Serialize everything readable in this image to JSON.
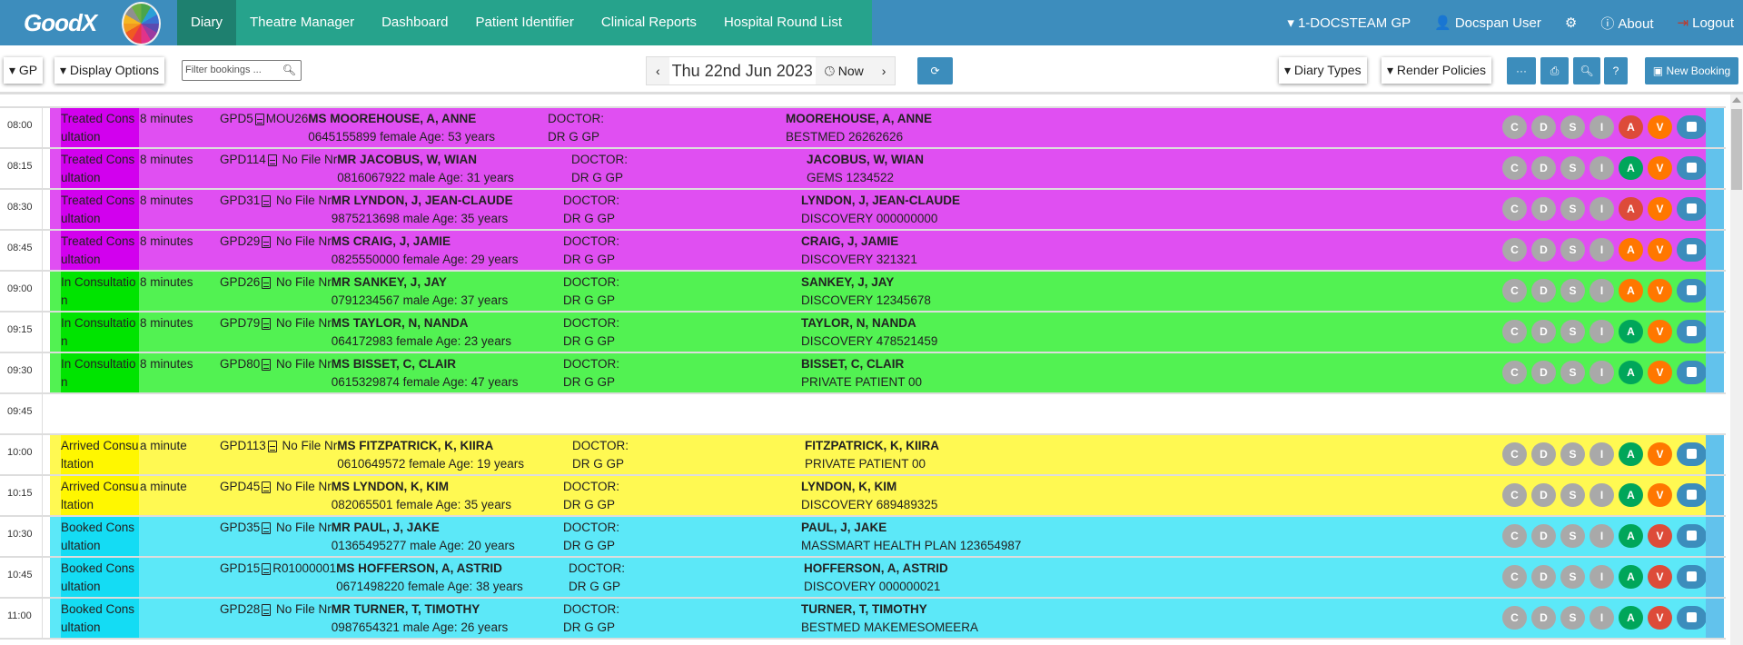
{
  "nav": {
    "logo_text": "GoodX",
    "tabs": [
      "Diary",
      "Theatre Manager",
      "Dashboard",
      "Patient Identifier",
      "Clinical Reports",
      "Hospital Round List"
    ],
    "practice": "1-DOCSTEAM GP",
    "user": "Docspan User",
    "about": "About",
    "logout": "Logout"
  },
  "toolbar": {
    "gp": "GP",
    "display_options": "Display Options",
    "filter_placeholder": "Filter bookings ...",
    "date": "Thu 22nd Jun 2023",
    "now": "Now",
    "diary_types": "Diary Types",
    "render_policies": "Render Policies",
    "more": "···",
    "help": "?",
    "new_booking": "New Booking"
  },
  "colors": {
    "Treated": {
      "band": "#e04ff2",
      "status": "#d200ee"
    },
    "In Consultation": {
      "band": "#52f252",
      "status": "#00e400"
    },
    "Arrived": {
      "band": "#fff952",
      "status": "#fff700"
    },
    "Booked": {
      "band": "#5ce8f8",
      "status": "#14dcf4"
    },
    "grey": "#a9a9a9",
    "red": "#dd4b39",
    "green": "#00a65a",
    "orange": "#ff7700"
  },
  "badge_letters": [
    "C",
    "D",
    "S",
    "I",
    "A",
    "V"
  ],
  "rows": [
    {
      "time": "08:00",
      "state": "Treated",
      "status": "Treated Consultation",
      "duration": "8 minutes",
      "code": "GPD5",
      "file": "MOU26",
      "name": "MS MOOREHOUSE, A, ANNE",
      "details": "0645155899 female Age: 53 years",
      "doctor_label": "DOCTOR:",
      "doctor": "DR G GP",
      "aid_name": "MOOREHOUSE, A, ANNE",
      "aid": "BESTMED 26262626",
      "a": "red",
      "v": "orange"
    },
    {
      "time": "08:15",
      "state": "Treated",
      "status": "Treated Consultation",
      "duration": "8 minutes",
      "code": "GPD114",
      "file": " No File Nr",
      "name": "MR JACOBUS, W, WIAN",
      "details": "0816067922 male Age: 31 years",
      "doctor_label": "DOCTOR:",
      "doctor": "DR G GP",
      "aid_name": "JACOBUS, W, WIAN",
      "aid": "GEMS 1234522",
      "a": "green",
      "v": "orange"
    },
    {
      "time": "08:30",
      "state": "Treated",
      "status": "Treated Consultation",
      "duration": "8 minutes",
      "code": "GPD31",
      "file": " No File Nr",
      "name": "MR LYNDON, J, JEAN-CLAUDE",
      "details": "9875213698 male Age: 35 years",
      "doctor_label": "DOCTOR:",
      "doctor": "DR G GP",
      "aid_name": "LYNDON, J, JEAN-CLAUDE",
      "aid": "DISCOVERY 000000000",
      "a": "red",
      "v": "orange"
    },
    {
      "time": "08:45",
      "state": "Treated",
      "status": "Treated Consultation",
      "duration": "8 minutes",
      "code": "GPD29",
      "file": " No File Nr",
      "name": "MS CRAIG, J, JAMIE",
      "details": "0825550000 female Age: 29 years",
      "doctor_label": "DOCTOR:",
      "doctor": "DR G GP",
      "aid_name": "CRAIG, J, JAMIE",
      "aid": "DISCOVERY 321321",
      "a": "orange",
      "v": "orange"
    },
    {
      "time": "09:00",
      "state": "In Consultation",
      "status": "In Consultation",
      "duration": "8 minutes",
      "code": "GPD26",
      "file": " No File Nr",
      "name": "MR SANKEY, J, JAY",
      "details": "0791234567 male Age: 37 years",
      "doctor_label": "DOCTOR:",
      "doctor": "DR G GP",
      "aid_name": "SANKEY, J, JAY",
      "aid": "DISCOVERY 12345678",
      "a": "orange",
      "v": "orange"
    },
    {
      "time": "09:15",
      "state": "In Consultation",
      "status": "In Consultation",
      "duration": "8 minutes",
      "code": "GPD79",
      "file": " No File Nr",
      "name": "MS TAYLOR, N, NANDA",
      "details": "064172983 female Age: 23 years",
      "doctor_label": "DOCTOR:",
      "doctor": "DR G GP",
      "aid_name": "TAYLOR, N, NANDA",
      "aid": "DISCOVERY 478521459",
      "a": "green",
      "v": "orange"
    },
    {
      "time": "09:30",
      "state": "In Consultation",
      "status": "In Consultation",
      "duration": "8 minutes",
      "code": "GPD80",
      "file": " No File Nr",
      "name": "MS BISSET, C, CLAIR",
      "details": "0615329874 female Age: 47 years",
      "doctor_label": "DOCTOR:",
      "doctor": "DR G GP",
      "aid_name": "BISSET, C, CLAIR",
      "aid": "PRIVATE PATIENT 00",
      "a": "green",
      "v": "orange"
    },
    {
      "time": "09:45",
      "empty": true
    },
    {
      "time": "10:00",
      "state": "Arrived",
      "status": "Arrived Consultation",
      "duration": "a minute",
      "code": "GPD113",
      "file": " No File Nr",
      "name": "MS FITZPATRICK, K, KIIRA",
      "details": "0610649572 female Age: 19 years",
      "doctor_label": "DOCTOR:",
      "doctor": "DR G GP",
      "aid_name": "FITZPATRICK, K, KIIRA",
      "aid": "PRIVATE PATIENT 00",
      "a": "green",
      "v": "orange"
    },
    {
      "time": "10:15",
      "state": "Arrived",
      "status": "Arrived Consultation",
      "duration": "a minute",
      "code": "GPD45",
      "file": " No File Nr",
      "name": "MS LYNDON, K, KIM",
      "details": "082065501 female Age: 35 years",
      "doctor_label": "DOCTOR:",
      "doctor": "DR G GP",
      "aid_name": "LYNDON, K, KIM",
      "aid": "DISCOVERY 689489325",
      "a": "green",
      "v": "orange"
    },
    {
      "time": "10:30",
      "state": "Booked",
      "status": "Booked Consultation",
      "duration": "",
      "code": "GPD35",
      "file": " No File Nr",
      "name": "MR PAUL, J, JAKE",
      "details": "01365495277 male Age: 20 years",
      "doctor_label": "DOCTOR:",
      "doctor": "DR G GP",
      "aid_name": "PAUL, J, JAKE",
      "aid": "MASSMART HEALTH PLAN 123654987",
      "a": "green",
      "v": "red"
    },
    {
      "time": "10:45",
      "state": "Booked",
      "status": "Booked Consultation",
      "duration": "",
      "code": "GPD15",
      "file": "R01000001",
      "name": "MS HOFFERSON, A, ASTRID",
      "details": "0671498220 female Age: 38 years",
      "doctor_label": "DOCTOR:",
      "doctor": "DR G GP",
      "aid_name": "HOFFERSON, A, ASTRID",
      "aid": "DISCOVERY 000000021",
      "a": "green",
      "v": "red"
    },
    {
      "time": "11:00",
      "state": "Booked",
      "status": "Booked Consultation",
      "duration": "",
      "code": "GPD28",
      "file": " No File Nr",
      "name": "MR TURNER, T, TIMOTHY",
      "details": "0987654321 male Age: 26 years",
      "doctor_label": "DOCTOR:",
      "doctor": "DR G GP",
      "aid_name": "TURNER, T, TIMOTHY",
      "aid": "BESTMED MAKEMESOMEERA",
      "a": "green",
      "v": "red"
    }
  ]
}
